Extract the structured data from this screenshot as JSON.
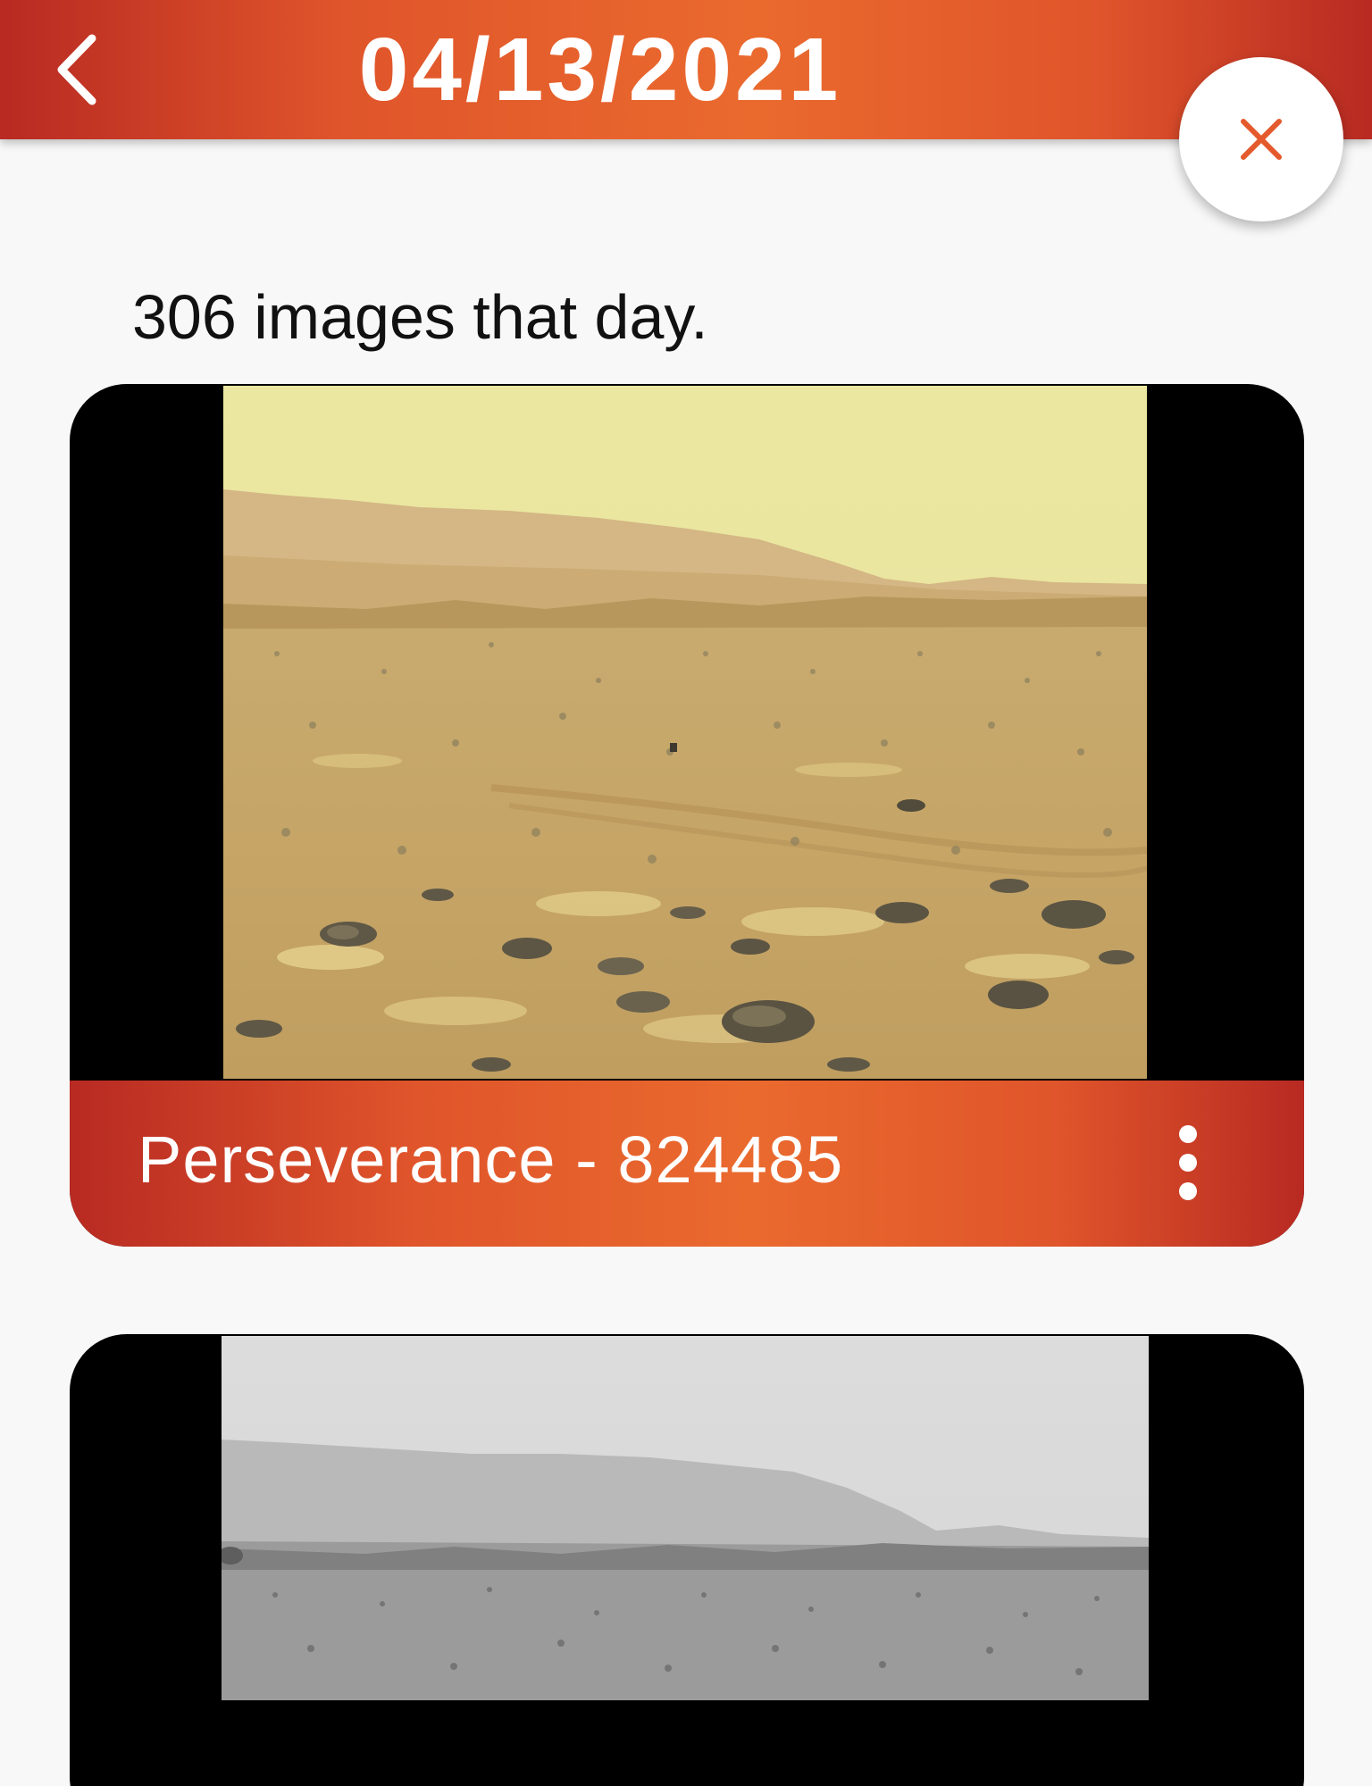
{
  "app_bar": {
    "title": "04/13/2021",
    "back_icon": "chevron-left-icon",
    "background_colors": [
      "#b82a22",
      "#ea6a2e"
    ]
  },
  "close_button": {
    "icon": "close-icon",
    "icon_color": "#e45a2c"
  },
  "summary": {
    "count_text": "306 images that day."
  },
  "photos": [
    {
      "footer_label": "Perseverance - 824485",
      "menu_icon": "more-vert-icon",
      "image_description": "mars-terrain-color"
    },
    {
      "image_description": "mars-terrain-grayscale"
    }
  ]
}
